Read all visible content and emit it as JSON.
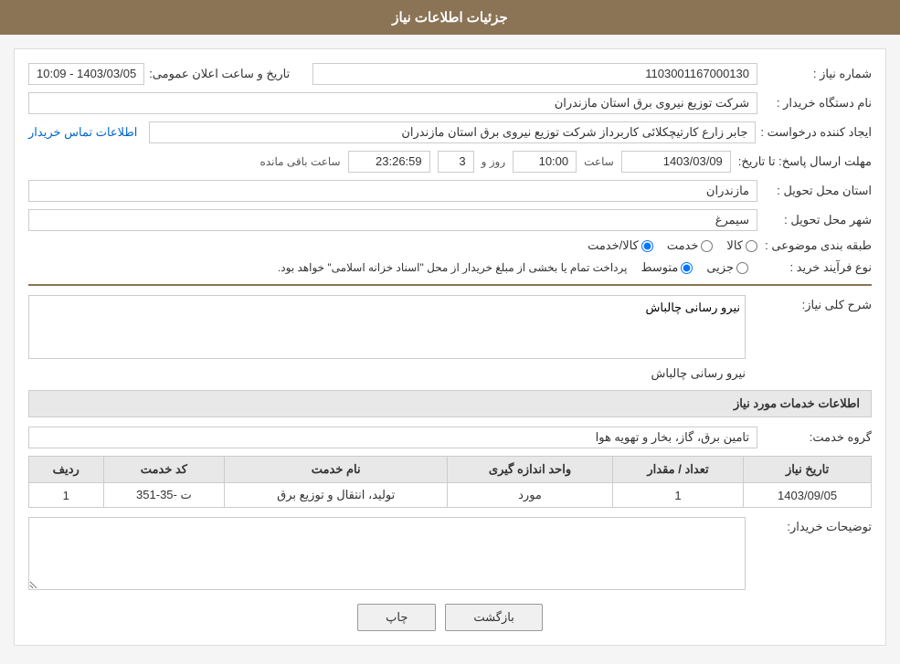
{
  "header": {
    "title": "جزئیات اطلاعات نیاز"
  },
  "fields": {
    "need_number_label": "شماره نیاز :",
    "need_number_value": "1103001167000130",
    "announce_label": "تاریخ و ساعت اعلان عمومی:",
    "announce_value": "1403/03/05 - 10:09",
    "buyer_org_label": "نام دستگاه خریدار :",
    "buyer_org_value": "شرکت توزیع نیروی برق استان مازندران",
    "creator_label": "ایجاد کننده درخواست :",
    "creator_value": "جابر زارع کارتیچکلائی کاربرداز شرکت توزیع نیروی برق استان مازندران",
    "contact_link": "اطلاعات تماس خریدار",
    "deadline_label": "مهلت ارسال پاسخ: تا تاریخ:",
    "deadline_date": "1403/03/09",
    "deadline_time_label": "ساعت",
    "deadline_time": "10:00",
    "deadline_day_label": "روز و",
    "deadline_days": "3",
    "deadline_remaining_label": "ساعت باقی مانده",
    "deadline_remaining": "23:26:59",
    "province_label": "استان محل تحویل :",
    "province_value": "مازندران",
    "city_label": "شهر محل تحویل :",
    "city_value": "سیمرغ",
    "category_label": "طبقه بندی موضوعی :",
    "category_options": [
      "کالا",
      "خدمت",
      "کالا/خدمت"
    ],
    "category_selected": "کالا",
    "purchase_label": "نوع فرآیند خرید :",
    "purchase_options": [
      "جزیی",
      "متوسط"
    ],
    "purchase_selected": "متوسط",
    "purchase_note": "پرداخت تمام یا بخشی از مبلغ خریدار از محل \"اسناد خزانه اسلامی\" خواهد بود.",
    "need_desc_label": "شرح کلی نیاز:",
    "need_desc_value": "نیرو رسانی چالباش",
    "services_section_label": "اطلاعات خدمات مورد نیاز",
    "service_group_label": "گروه خدمت:",
    "service_group_value": "تامین برق، گاز، بخار و تهویه هوا",
    "table_headers": {
      "row_num": "ردیف",
      "service_code": "کد خدمت",
      "service_name": "نام خدمت",
      "measure_unit": "واحد اندازه گیری",
      "quantity": "تعداد / مقدار",
      "date": "تاریخ نیاز"
    },
    "table_rows": [
      {
        "row_num": "1",
        "service_code": "ت -35-351",
        "service_name": "تولید، انتقال و توزیع برق",
        "measure_unit": "مورد",
        "quantity": "1",
        "date": "1403/09/05"
      }
    ],
    "buyer_notes_label": "توضیحات خریدار:",
    "buyer_notes_value": ""
  },
  "buttons": {
    "back_label": "بازگشت",
    "print_label": "چاپ"
  }
}
